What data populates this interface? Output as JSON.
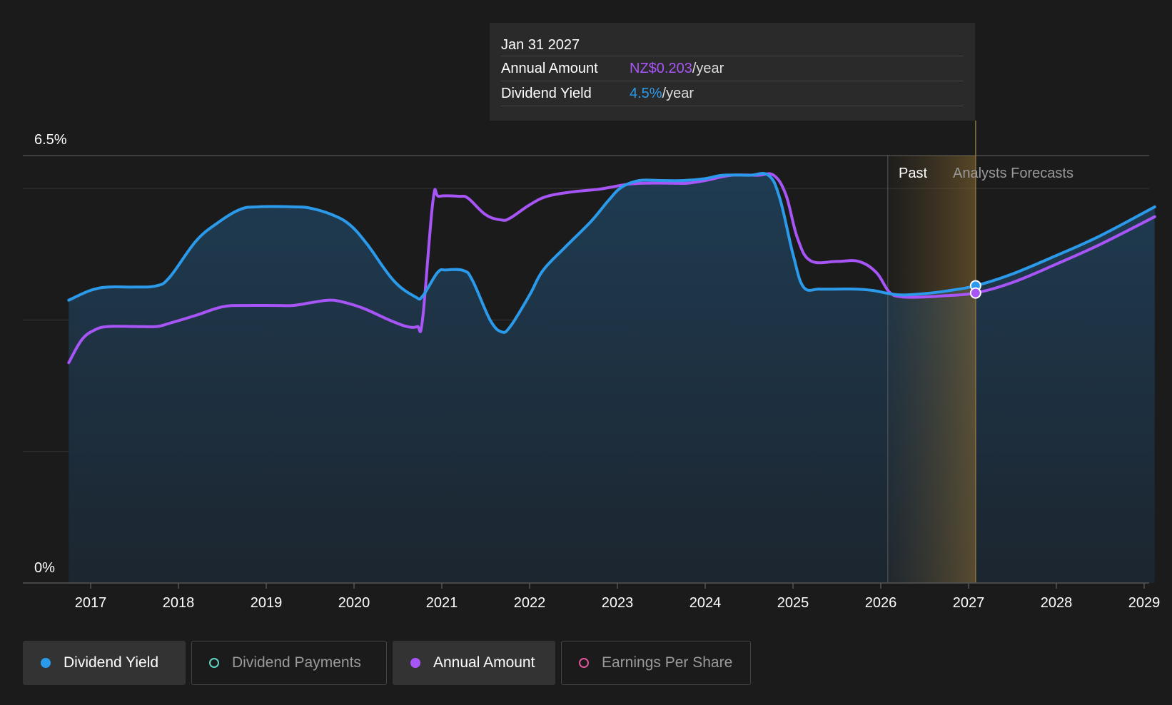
{
  "chart_data": {
    "type": "area",
    "y_top_label": "6.5%",
    "y_bottom_label": "0%",
    "x_ticks": [
      "2017",
      "2018",
      "2019",
      "2020",
      "2021",
      "2022",
      "2023",
      "2024",
      "2025",
      "2026",
      "2027",
      "2028",
      "2029"
    ],
    "xlim": [
      2016.75,
      2029.12
    ],
    "ylim": [
      0,
      6.5
    ],
    "grid": true,
    "past_label": "Past",
    "forecast_label": "Analysts Forecasts",
    "forecast_start": 2026.08,
    "cursor_x": 2027.08,
    "series": [
      {
        "name": "Dividend Yield",
        "color": "#2b9aea",
        "fill": true,
        "points": [
          [
            2016.75,
            4.3
          ],
          [
            2017.0,
            4.45
          ],
          [
            2017.2,
            4.5
          ],
          [
            2017.5,
            4.5
          ],
          [
            2017.75,
            4.52
          ],
          [
            2017.9,
            4.65
          ],
          [
            2018.2,
            5.2
          ],
          [
            2018.45,
            5.48
          ],
          [
            2018.7,
            5.68
          ],
          [
            2018.9,
            5.72
          ],
          [
            2019.3,
            5.72
          ],
          [
            2019.5,
            5.7
          ],
          [
            2019.75,
            5.6
          ],
          [
            2019.95,
            5.45
          ],
          [
            2020.15,
            5.15
          ],
          [
            2020.45,
            4.6
          ],
          [
            2020.7,
            4.35
          ],
          [
            2020.78,
            4.36
          ],
          [
            2020.95,
            4.72
          ],
          [
            2021.05,
            4.76
          ],
          [
            2021.25,
            4.75
          ],
          [
            2021.35,
            4.6
          ],
          [
            2021.55,
            4.0
          ],
          [
            2021.68,
            3.82
          ],
          [
            2021.78,
            3.9
          ],
          [
            2022.0,
            4.38
          ],
          [
            2022.15,
            4.75
          ],
          [
            2022.4,
            5.1
          ],
          [
            2022.7,
            5.5
          ],
          [
            2022.9,
            5.82
          ],
          [
            2023.05,
            6.02
          ],
          [
            2023.25,
            6.12
          ],
          [
            2023.5,
            6.12
          ],
          [
            2023.75,
            6.12
          ],
          [
            2024.0,
            6.15
          ],
          [
            2024.2,
            6.2
          ],
          [
            2024.5,
            6.2
          ],
          [
            2024.72,
            6.2
          ],
          [
            2024.85,
            5.85
          ],
          [
            2025.0,
            5.0
          ],
          [
            2025.12,
            4.5
          ],
          [
            2025.3,
            4.47
          ],
          [
            2025.5,
            4.47
          ],
          [
            2025.7,
            4.47
          ],
          [
            2025.9,
            4.45
          ],
          [
            2026.1,
            4.4
          ],
          [
            2026.25,
            4.38
          ],
          [
            2026.5,
            4.4
          ],
          [
            2026.75,
            4.44
          ],
          [
            2027.08,
            4.52
          ],
          [
            2027.5,
            4.7
          ],
          [
            2028.0,
            4.98
          ],
          [
            2028.5,
            5.28
          ],
          [
            2029.12,
            5.72
          ]
        ]
      },
      {
        "name": "Annual Amount",
        "color": "#a855f7",
        "fill": false,
        "points": [
          [
            2016.75,
            3.35
          ],
          [
            2016.9,
            3.7
          ],
          [
            2017.05,
            3.85
          ],
          [
            2017.2,
            3.9
          ],
          [
            2017.5,
            3.9
          ],
          [
            2017.75,
            3.9
          ],
          [
            2017.9,
            3.95
          ],
          [
            2018.2,
            4.07
          ],
          [
            2018.5,
            4.2
          ],
          [
            2018.75,
            4.22
          ],
          [
            2019.1,
            4.22
          ],
          [
            2019.3,
            4.22
          ],
          [
            2019.5,
            4.26
          ],
          [
            2019.7,
            4.3
          ],
          [
            2019.85,
            4.28
          ],
          [
            2020.1,
            4.18
          ],
          [
            2020.4,
            4.0
          ],
          [
            2020.6,
            3.9
          ],
          [
            2020.72,
            3.9
          ],
          [
            2020.78,
            4.0
          ],
          [
            2020.9,
            5.82
          ],
          [
            2020.97,
            5.88
          ],
          [
            2021.2,
            5.88
          ],
          [
            2021.3,
            5.85
          ],
          [
            2021.5,
            5.6
          ],
          [
            2021.68,
            5.52
          ],
          [
            2021.78,
            5.55
          ],
          [
            2022.0,
            5.75
          ],
          [
            2022.2,
            5.88
          ],
          [
            2022.5,
            5.95
          ],
          [
            2022.8,
            5.99
          ],
          [
            2023.1,
            6.06
          ],
          [
            2023.3,
            6.08
          ],
          [
            2023.6,
            6.08
          ],
          [
            2023.8,
            6.08
          ],
          [
            2024.0,
            6.12
          ],
          [
            2024.3,
            6.2
          ],
          [
            2024.6,
            6.2
          ],
          [
            2024.78,
            6.2
          ],
          [
            2024.92,
            5.9
          ],
          [
            2025.05,
            5.25
          ],
          [
            2025.2,
            4.9
          ],
          [
            2025.5,
            4.89
          ],
          [
            2025.75,
            4.89
          ],
          [
            2025.95,
            4.72
          ],
          [
            2026.1,
            4.42
          ],
          [
            2026.25,
            4.35
          ],
          [
            2026.5,
            4.35
          ],
          [
            2026.75,
            4.37
          ],
          [
            2027.08,
            4.41
          ],
          [
            2027.5,
            4.57
          ],
          [
            2028.0,
            4.85
          ],
          [
            2028.5,
            5.15
          ],
          [
            2029.12,
            5.57
          ]
        ]
      }
    ]
  },
  "tooltip": {
    "date": "Jan 31 2027",
    "annual_label": "Annual Amount",
    "annual_value": "NZ$0.203",
    "annual_unit": "/year",
    "yield_label": "Dividend Yield",
    "yield_value": "4.5%",
    "yield_unit": "/year"
  },
  "legend": {
    "dividend_yield": "Dividend Yield",
    "dividend_payments": "Dividend Payments",
    "annual_amount": "Annual Amount",
    "earnings_per_share": "Earnings Per Share"
  },
  "colors": {
    "blue": "#2b9aea",
    "purple": "#a855f7",
    "teal": "#5fd4c0",
    "pink": "#e0559a",
    "background": "#1b1b1b"
  }
}
